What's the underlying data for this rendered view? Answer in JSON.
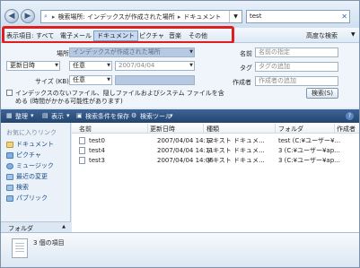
{
  "address": {
    "segments": [
      "検索場所: インデックスが作成された場所",
      "ドキュメント"
    ],
    "search_value": "test"
  },
  "filter_bar": {
    "label": "表示項目:",
    "items": [
      "すべて",
      "電子メール",
      "ドキュメント",
      "ピクチャ",
      "音楽",
      "その他"
    ],
    "selected": "ドキュメント",
    "advanced": "高度な検索"
  },
  "search_panel": {
    "location_label": "場所",
    "location_value": "インデックスが作成された場所",
    "date_field": "更新日時",
    "date_op": "任意",
    "date_value": "2007/04/04",
    "size_label": "サイズ (KB)",
    "size_op": "任意",
    "name_label": "名前",
    "name_placeholder": "名前の指定",
    "tag_label": "タグ",
    "tag_placeholder": "タグの追加",
    "author_label": "作成者",
    "author_placeholder": "作成者の追加",
    "include_text_line1": "インデックスのないファイル、隠しファイルおよびシステム ファイルを含",
    "include_text_line2": "める (時間がかかる可能性があります)",
    "search_button": "検索(S)"
  },
  "toolbar": {
    "organize": "整理",
    "view": "表示",
    "save_search": "検索条件を保存",
    "search_tools": "検索ツール"
  },
  "nav": {
    "title": "お気に入りリンク",
    "items": [
      "ドキュメント",
      "ピクチャ",
      "ミュージック",
      "最近の変更",
      "検索",
      "パブリック"
    ],
    "folders_label": "フォルダ"
  },
  "file_list": {
    "columns": [
      "名前",
      "更新日時",
      "種類",
      "フォルダ",
      "作成者"
    ],
    "rows": [
      {
        "name": "test0",
        "date": "2007/04/04 14:12",
        "type": "テキスト ドキュメ...",
        "folder": "test (C:¥ユーザー¥..."
      },
      {
        "name": "test4",
        "date": "2007/04/04 14:11",
        "type": "テキスト ドキュメ...",
        "folder": "3 (C:¥ユーザー¥ap..."
      },
      {
        "name": "test3",
        "date": "2007/04/04 14:06",
        "type": "テキスト ドキュメ...",
        "folder": "3 (C:¥ユーザー¥ap..."
      }
    ]
  },
  "details": {
    "count_text": "3 個の項目"
  }
}
